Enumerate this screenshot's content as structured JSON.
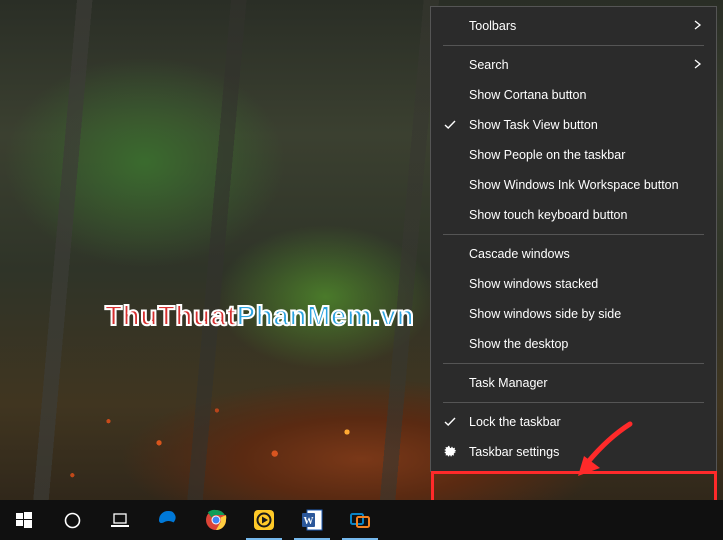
{
  "watermark": {
    "part1": "ThuThuat",
    "part2": "PhanMem.vn"
  },
  "context_menu": {
    "items": [
      {
        "label": "Toolbars",
        "has_submenu": true
      },
      {
        "separator": true
      },
      {
        "label": "Search",
        "has_submenu": true
      },
      {
        "label": "Show Cortana button"
      },
      {
        "label": "Show Task View button",
        "checked": true
      },
      {
        "label": "Show People on the taskbar"
      },
      {
        "label": "Show Windows Ink Workspace button"
      },
      {
        "label": "Show touch keyboard button"
      },
      {
        "separator": true
      },
      {
        "label": "Cascade windows"
      },
      {
        "label": "Show windows stacked"
      },
      {
        "label": "Show windows side by side"
      },
      {
        "label": "Show the desktop"
      },
      {
        "separator": true
      },
      {
        "label": "Task Manager"
      },
      {
        "separator": true
      },
      {
        "label": "Lock the taskbar",
        "checked": true
      },
      {
        "label": "Taskbar settings",
        "icon": "gear"
      }
    ]
  },
  "taskbar": {
    "apps": [
      {
        "name": "start",
        "running": false
      },
      {
        "name": "cortana",
        "running": false
      },
      {
        "name": "task-view",
        "running": false
      },
      {
        "name": "edge",
        "running": false
      },
      {
        "name": "chrome",
        "running": false
      },
      {
        "name": "potplayer",
        "running": true
      },
      {
        "name": "word",
        "running": true
      },
      {
        "name": "vmware",
        "running": true
      }
    ]
  },
  "annotation": {
    "highlight_target": "Taskbar settings"
  }
}
